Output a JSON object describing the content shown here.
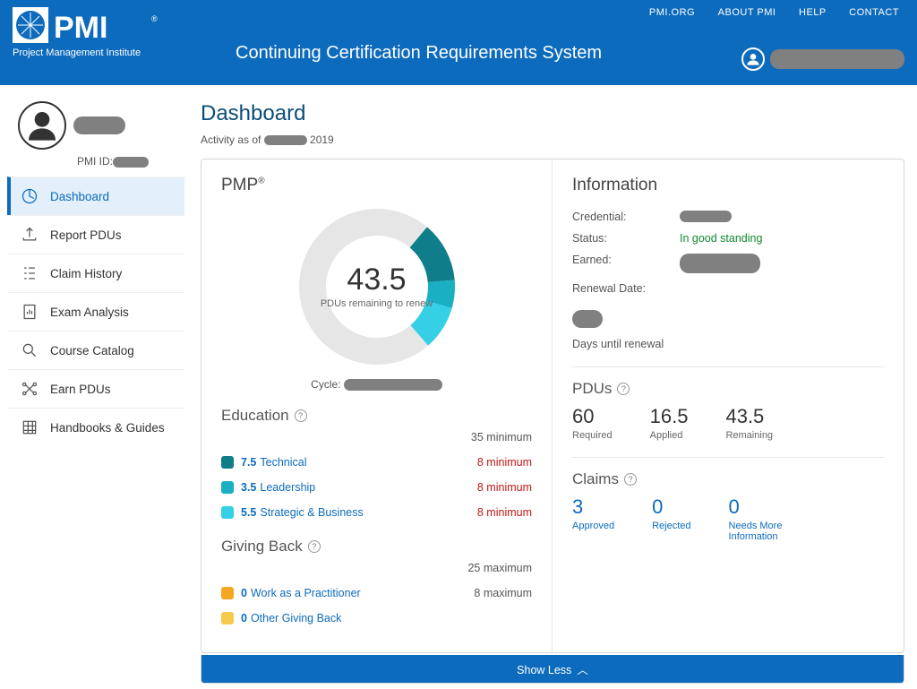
{
  "header": {
    "nav": [
      "PMI.ORG",
      "ABOUT PMI",
      "HELP",
      "CONTACT"
    ],
    "org_line1": "PMI",
    "org_line2": "Project Management Institute",
    "system_title": "Continuing Certification Requirements System"
  },
  "profile": {
    "pmi_id_label": "PMI ID:"
  },
  "sidebar": {
    "items": [
      {
        "label": "Dashboard"
      },
      {
        "label": "Report PDUs"
      },
      {
        "label": "Claim History"
      },
      {
        "label": "Exam Analysis"
      },
      {
        "label": "Course Catalog"
      },
      {
        "label": "Earn PDUs"
      },
      {
        "label": "Handbooks & Guides"
      }
    ]
  },
  "page": {
    "title": "Dashboard",
    "activity_prefix": "Activity as of ",
    "activity_year": " 2019"
  },
  "cert": {
    "name": "PMP",
    "donut_value": "43.5",
    "donut_label": "PDUs remaining to renew",
    "cycle_label": "Cycle:"
  },
  "education": {
    "heading": "Education",
    "overall_min": "35 minimum",
    "rows": [
      {
        "color": "#0f7e8a",
        "value": "7.5",
        "name": "Technical",
        "min": "8 minimum",
        "min_red": true
      },
      {
        "color": "#19b0c4",
        "value": "3.5",
        "name": "Leadership",
        "min": "8 minimum",
        "min_red": true
      },
      {
        "color": "#35d0e6",
        "value": "5.5",
        "name": "Strategic & Business",
        "min": "8 minimum",
        "min_red": true
      }
    ]
  },
  "giving": {
    "heading": "Giving Back",
    "overall_max": "25 maximum",
    "rows": [
      {
        "color": "#f5a623",
        "value": "0",
        "name": "Work as a Practitioner",
        "min": "8 maximum",
        "min_red": false
      },
      {
        "color": "#f5c94b",
        "value": "0",
        "name": "Other Giving Back",
        "min": "",
        "min_red": false
      }
    ]
  },
  "info": {
    "heading": "Information",
    "rows": {
      "credential": "Credential:",
      "status": "Status:",
      "status_val": "In good standing",
      "earned": "Earned:",
      "renewal": "Renewal Date:"
    },
    "days_label": "Days until renewal"
  },
  "pdus": {
    "heading": "PDUs",
    "stats": [
      {
        "n": "60",
        "l": "Required"
      },
      {
        "n": "16.5",
        "l": "Applied"
      },
      {
        "n": "43.5",
        "l": "Remaining"
      }
    ]
  },
  "claims": {
    "heading": "Claims",
    "stats": [
      {
        "n": "3",
        "l": "Approved"
      },
      {
        "n": "0",
        "l": "Rejected"
      },
      {
        "n": "0",
        "l": "Needs More Information"
      }
    ]
  },
  "showless": "Show Less",
  "chart_data": {
    "type": "pie",
    "title": "PDUs remaining to renew",
    "total": 60,
    "remaining": 43.5,
    "applied": 16.5,
    "segments": [
      {
        "name": "Technical",
        "value": 7.5,
        "color": "#0f7e8a"
      },
      {
        "name": "Leadership",
        "value": 3.5,
        "color": "#19b0c4"
      },
      {
        "name": "Strategic & Business",
        "value": 5.5,
        "color": "#35d0e6"
      },
      {
        "name": "Remaining",
        "value": 43.5,
        "color": "#e6e6e6"
      }
    ]
  }
}
